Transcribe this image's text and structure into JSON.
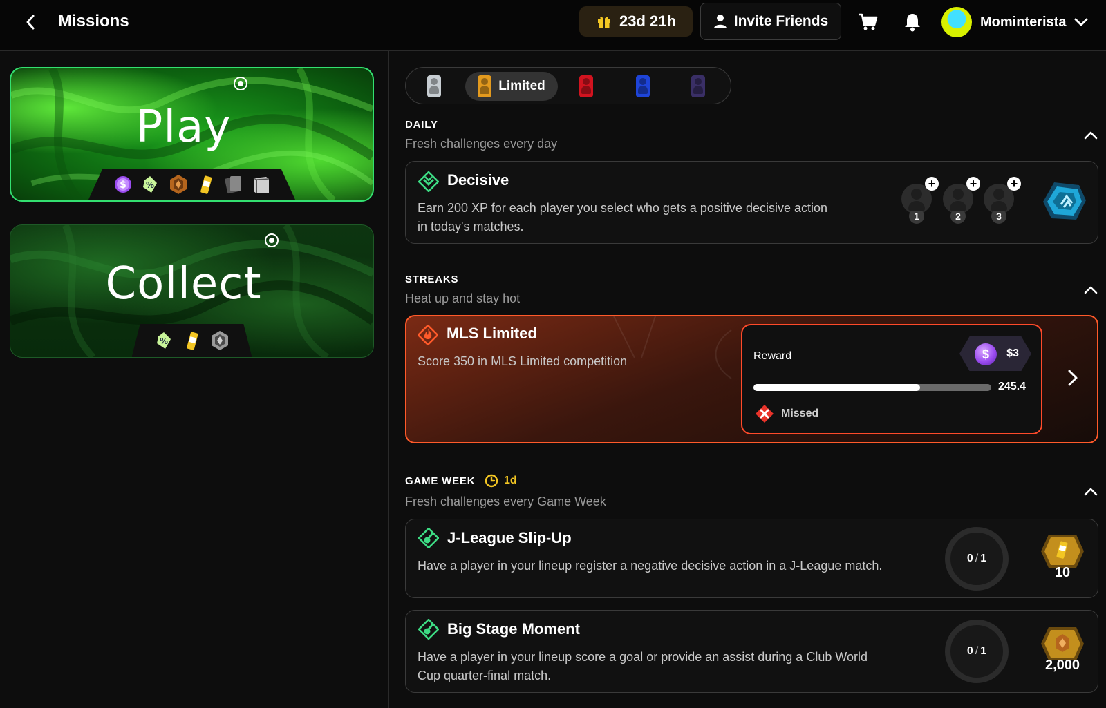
{
  "header": {
    "title": "Missions",
    "timer": "23d 21h",
    "invite_label": "Invite Friends",
    "username": "Mominterista"
  },
  "modes": {
    "play": {
      "title": "Play",
      "tray_icons": [
        "coin-icon",
        "discount-tag-icon",
        "bronze-badge-icon",
        "energy-drink-icon",
        "card-pack-icon",
        "box-icon"
      ]
    },
    "collect": {
      "title": "Collect",
      "tray_icons": [
        "discount-tag-icon",
        "energy-drink-icon",
        "silver-badge-icon"
      ]
    }
  },
  "tabs": {
    "items": [
      {
        "name": "common",
        "color": "#c7cdd2"
      },
      {
        "name": "limited",
        "label": "Limited",
        "color": "#e39a1e",
        "active": true
      },
      {
        "name": "rare",
        "color": "#d1131f"
      },
      {
        "name": "super-rare",
        "color": "#1e44d8"
      },
      {
        "name": "unique",
        "color": "#3a2f66"
      }
    ]
  },
  "daily": {
    "label": "DAILY",
    "subtitle": "Fresh challenges every day",
    "mission": {
      "name": "Decisive",
      "description_line1": "Earn 200 XP for each player you select who gets a positive decisive action",
      "description_line2": "in today's matches.",
      "slots": [
        "1",
        "2",
        "3"
      ]
    }
  },
  "streaks": {
    "label": "STREAKS",
    "subtitle": "Heat up and stay hot",
    "mission": {
      "name": "MLS Limited",
      "description": "Score 350 in MLS Limited competition",
      "reward_label": "Reward",
      "reward_value": "$3",
      "coin_symbol": "$",
      "progress_value": "245.4",
      "progress_fraction": 0.701,
      "status": "Missed"
    }
  },
  "game_week": {
    "label": "GAME WEEK",
    "timer": "1d",
    "subtitle": "Fresh challenges every Game Week",
    "missions": [
      {
        "name": "J-League Slip-Up",
        "description_line1": "Have a player in your lineup register a negative decisive action in a J-League match.",
        "description_line2": "",
        "progress_current": "0",
        "progress_total": "1",
        "reward_amount": "10"
      },
      {
        "name": "Big Stage Moment",
        "description_line1": "Have a player in your lineup score a goal or provide an assist during a Club World",
        "description_line2": "Cup quarter-final match.",
        "progress_current": "0",
        "progress_total": "1",
        "reward_amount": "2,000"
      }
    ]
  },
  "colors": {
    "accent_green": "#33e070",
    "streak_orange": "#ff5a2a",
    "timer_gold": "#f3c623"
  }
}
